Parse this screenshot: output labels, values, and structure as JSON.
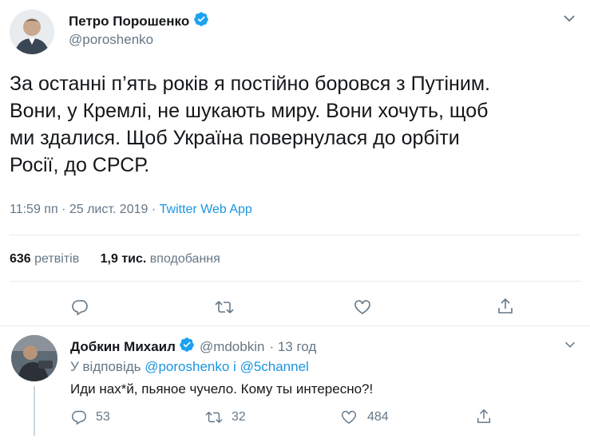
{
  "main_tweet": {
    "author_name": "Петро Порошенко",
    "handle": "@poroshenko",
    "text_lines": [
      "За останні п’ять років я постійно боровся з Путіним.",
      "Вони, у Кремлі, не шукають миру. Вони хочуть, щоб",
      "ми здалися. Щоб Україна повернулася до орбіти",
      "Росії, до СРСР."
    ],
    "time": "11:59 пп · 25 лист. 2019 · ",
    "source": "Twitter Web App",
    "retweets_count": "636",
    "retweets_label": "ретвітів",
    "likes_count": "1,9 тис.",
    "likes_label": "вподобання"
  },
  "reply": {
    "author_name": "Добкин Михаил",
    "handle": "@mdobkin",
    "age": "· 13 год",
    "reply_prefix": "У відповідь ",
    "reply_user1": "@poroshenko",
    "reply_conj": " і ",
    "reply_user2": "@5channel",
    "text": "Иди нах*й, пьяное чучело. Кому ты интересно?!",
    "reply_count": "53",
    "retweet_count": "32",
    "like_count": "484"
  },
  "colors": {
    "accent": "#1b95e0",
    "verified": "#1da1f2",
    "muted": "#657786"
  }
}
